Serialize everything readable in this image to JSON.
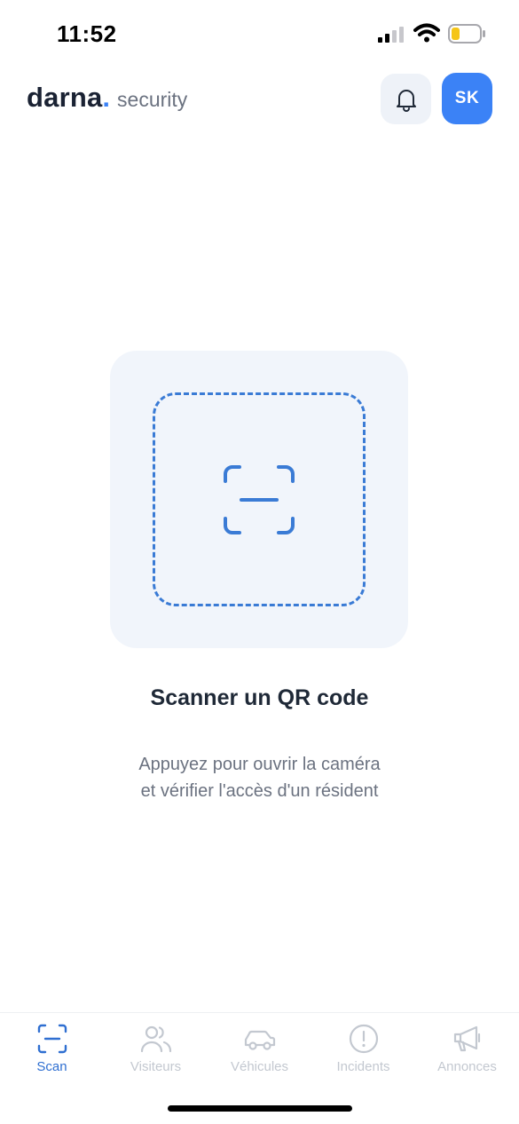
{
  "status_bar": {
    "time": "11:52"
  },
  "header": {
    "brand_name": "darna",
    "brand_dot": ".",
    "brand_sub": "security",
    "avatar_initials": "SK",
    "bell_icon": "bell-icon"
  },
  "main": {
    "title": "Scanner un QR code",
    "description_line1": "Appuyez pour ouvrir la caméra",
    "description_line2": "et vérifier l'accès d'un résident",
    "scan_icon": "scan-icon"
  },
  "bottom_nav": {
    "items": [
      {
        "label": "Scan",
        "icon": "scan-icon",
        "active": true
      },
      {
        "label": "Visiteurs",
        "icon": "users-icon",
        "active": false
      },
      {
        "label": "Véhicules",
        "icon": "car-icon",
        "active": false
      },
      {
        "label": "Incidents",
        "icon": "alert-circle-icon",
        "active": false
      },
      {
        "label": "Annonces",
        "icon": "megaphone-icon",
        "active": false
      }
    ]
  },
  "colors": {
    "accent": "#3b82f6",
    "active_nav": "#2f6fd1",
    "inactive_nav": "#c3c8d0",
    "card_bg": "#f1f5fb",
    "dashed_frame": "#3a7bd5"
  }
}
